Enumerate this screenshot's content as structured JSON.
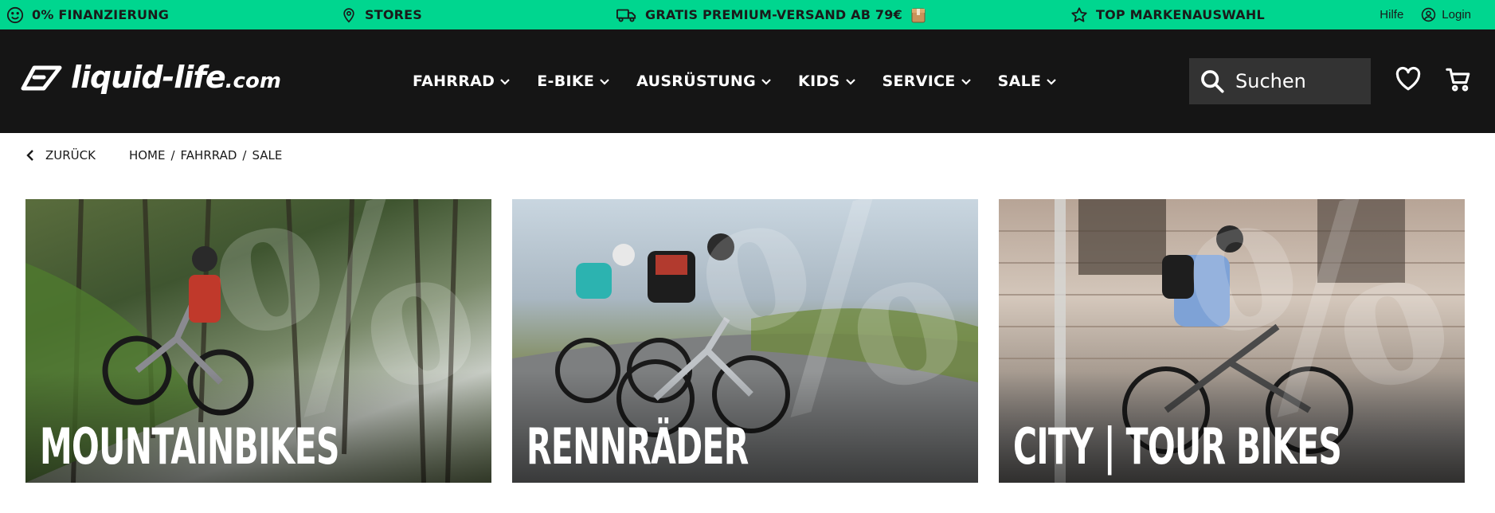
{
  "topbar": {
    "bg_color": "#00d68f",
    "promos": [
      {
        "icon": "smiley-icon",
        "text": "0% FINANZIERUNG"
      },
      {
        "icon": "map-pin-icon",
        "text": "STORES"
      },
      {
        "icon": "truck-icon",
        "text": "GRATIS PREMIUM-VERSAND AB 79€",
        "extra_icon": "package-icon"
      },
      {
        "icon": "star-icon",
        "text": "TOP MARKENAUSWAHL"
      }
    ],
    "help_label": "Hilfe",
    "login_label": "Login",
    "login_icon": "user-circle-icon"
  },
  "header": {
    "bg_color": "#151515",
    "logo_main": "liquid-life",
    "logo_domain": ".com",
    "nav": [
      {
        "label": "FAHRRAD"
      },
      {
        "label": "E-BIKE"
      },
      {
        "label": "AUSRÜSTUNG"
      },
      {
        "label": "KIDS"
      },
      {
        "label": "SERVICE"
      },
      {
        "label": "SALE"
      }
    ],
    "search_placeholder": "Suchen",
    "icons": [
      "search-icon",
      "heart-icon",
      "cart-icon"
    ]
  },
  "breadcrumb": {
    "back_label": "ZURÜCK",
    "items": [
      "HOME",
      "FAHRRAD",
      "SALE"
    ],
    "separator": "/"
  },
  "tiles": [
    {
      "label": "MOUNTAINBIKES"
    },
    {
      "label": "RENNRÄDER"
    },
    {
      "label": "CITY | TOUR BIKES"
    }
  ]
}
